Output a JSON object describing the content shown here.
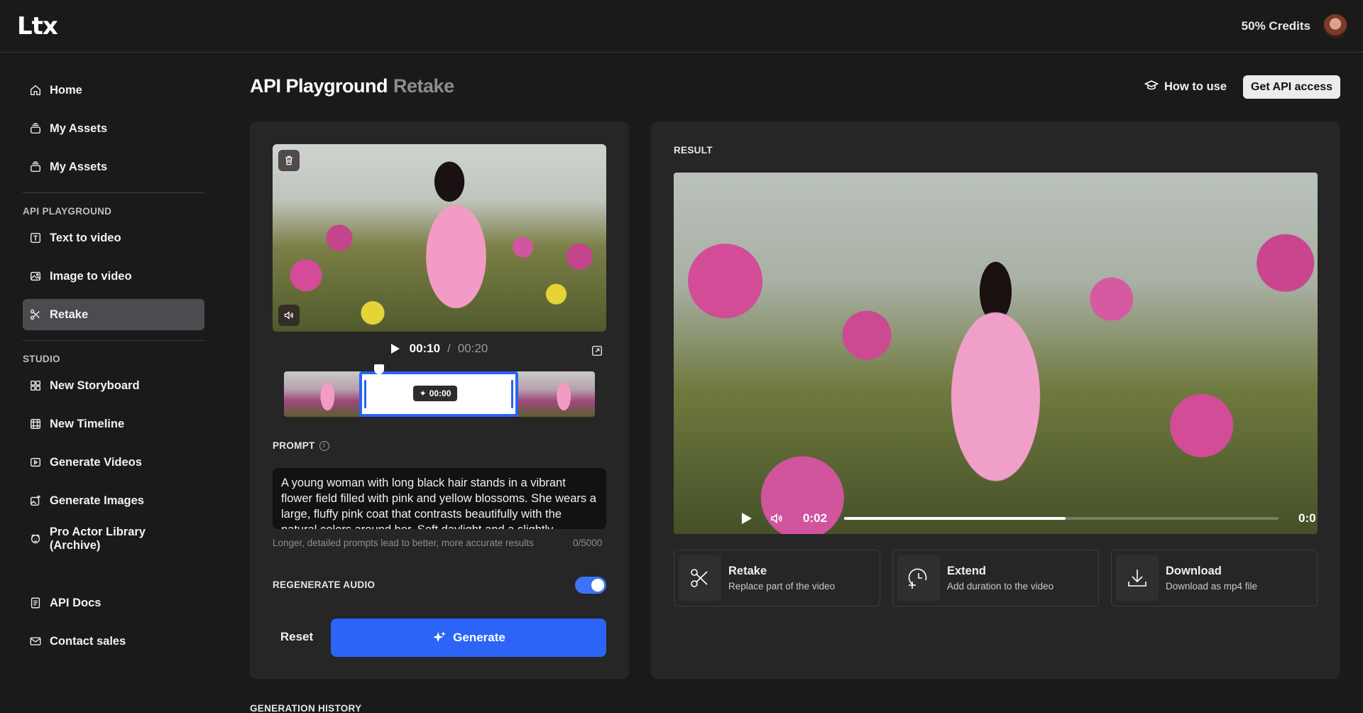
{
  "app": {
    "logo": "Ltx",
    "credits": "50% Credits"
  },
  "sidebar": {
    "top_items": [
      {
        "label": "Home",
        "icon": "home-icon"
      },
      {
        "label": "My Assets",
        "icon": "stack-icon"
      },
      {
        "label": "My Assets",
        "icon": "stack-icon"
      }
    ],
    "api_section_label": "API PLAYGROUND",
    "api_items": [
      {
        "label": "Text to video",
        "icon": "text-icon"
      },
      {
        "label": "Image to video",
        "icon": "image-icon"
      },
      {
        "label": "Retake",
        "icon": "scissors-icon",
        "active": true
      }
    ],
    "studio_section_label": "STUDIO",
    "studio_items": [
      {
        "label": "New Storyboard",
        "icon": "grid-icon"
      },
      {
        "label": "New Timeline",
        "icon": "film-icon"
      },
      {
        "label": "Generate Videos",
        "icon": "play-box-icon"
      },
      {
        "label": "Generate Images",
        "icon": "image-plus-icon"
      },
      {
        "label": "Pro Actor Library (Archive)",
        "icon": "actor-icon"
      }
    ],
    "bottom_items": [
      {
        "label": "API Docs",
        "icon": "doc-icon"
      },
      {
        "label": "Contact sales",
        "icon": "mail-icon"
      }
    ]
  },
  "header": {
    "title": "API Playground",
    "subtitle": "Retake",
    "how_to_use": "How to use",
    "get_api_access": "Get API access"
  },
  "editor": {
    "current_time": "00:10",
    "separator": "/",
    "total_time": "00:20",
    "selection_badge": "00:00",
    "prompt_label": "PROMPT",
    "prompt_text": "A young woman with long black hair stands in a vibrant flower field filled with pink and yellow blossoms. She wears a large, fluffy pink coat that contrasts beautifully with the natural colors around her. Soft daylight and a slightly",
    "prompt_hint": "Longer, detailed prompts lead to better, more accurate results",
    "prompt_counter": "0/5000",
    "regenerate_audio_label": "REGENERATE AUDIO",
    "regenerate_audio_on": true,
    "reset_label": "Reset",
    "generate_label": "Generate"
  },
  "result": {
    "label": "RESULT",
    "current_time": "0:02",
    "duration": "0:0",
    "progress": 0.51,
    "actions": [
      {
        "title": "Retake",
        "desc": "Replace part of the video",
        "icon": "scissors-icon"
      },
      {
        "title": "Extend",
        "desc": "Add duration to the video",
        "icon": "clock-plus-icon"
      },
      {
        "title": "Download",
        "desc": "Download as mp4 file",
        "icon": "download-icon"
      }
    ]
  },
  "history_label": "GENERATION HISTORY",
  "colors": {
    "accent": "#2b64f7",
    "background": "#1a1a1a",
    "panel": "#262626",
    "active_nav": "#4b4c50"
  }
}
